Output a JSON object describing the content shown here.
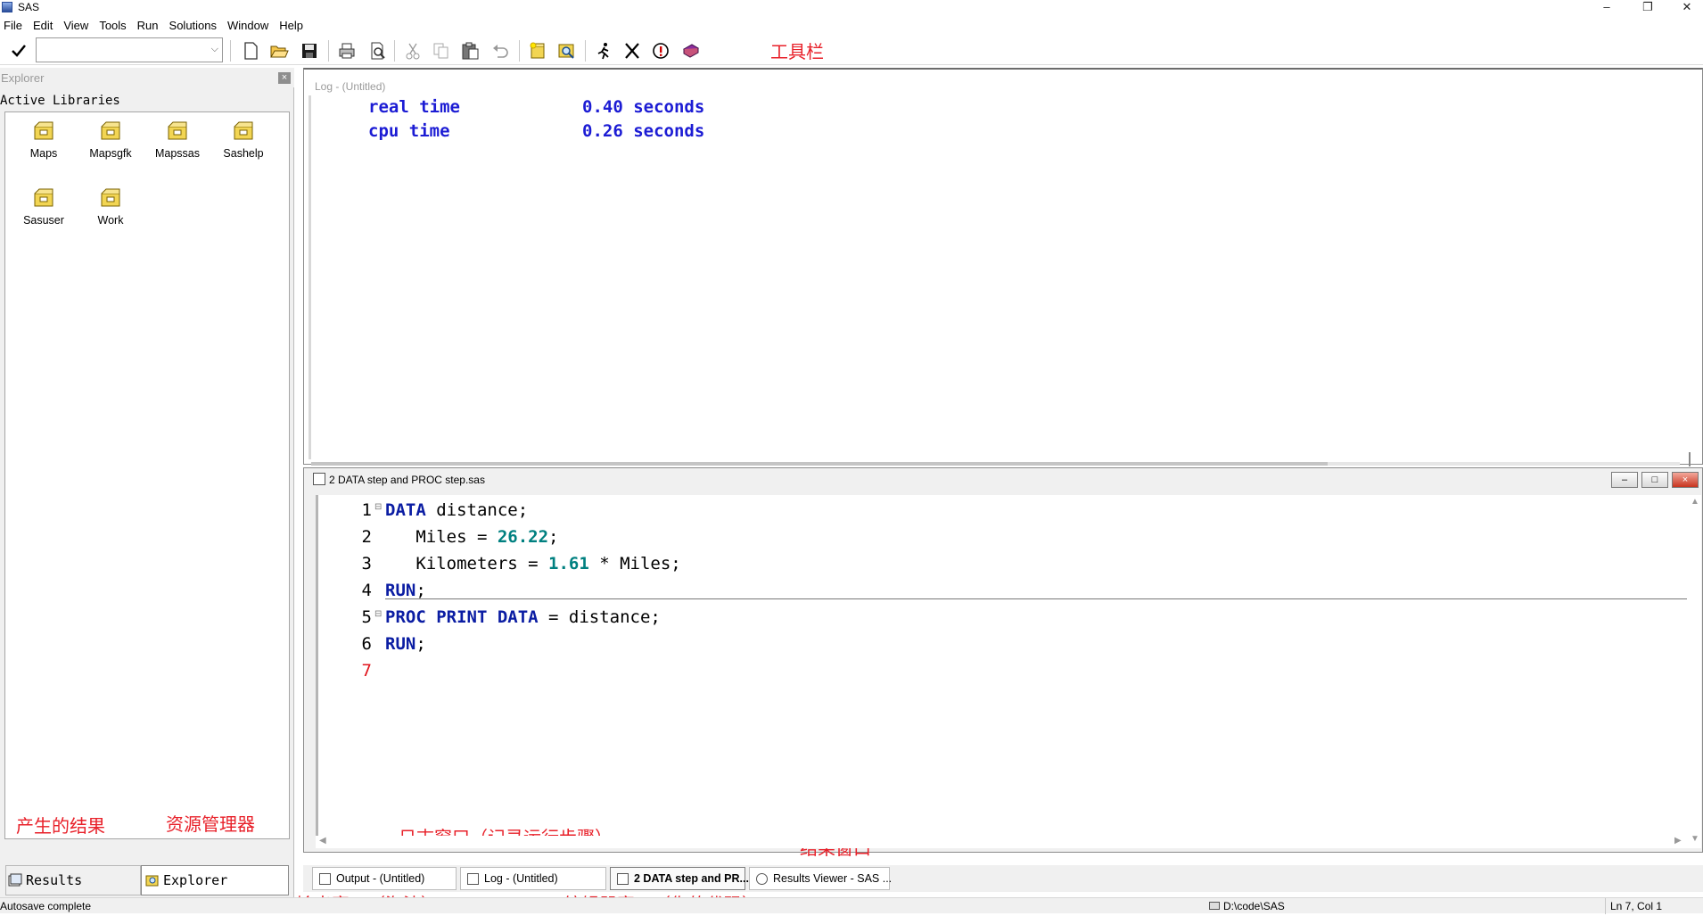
{
  "app": {
    "title": "SAS"
  },
  "menu": [
    "File",
    "Edit",
    "View",
    "Tools",
    "Run",
    "Solutions",
    "Window",
    "Help"
  ],
  "toolbar": {
    "command_value": "",
    "annotation": "工具栏",
    "icons": [
      "check-icon",
      "new-icon",
      "open-icon",
      "save-icon",
      "print-icon",
      "print-preview-icon",
      "cut-icon",
      "copy-icon",
      "paste-icon",
      "undo-icon",
      "new-library-icon",
      "explorer-icon",
      "submit-icon",
      "clear-icon",
      "break-icon",
      "help-icon"
    ]
  },
  "explorer": {
    "title": "Explorer",
    "heading": "Active Libraries",
    "libraries": [
      "Maps",
      "Mapsgfk",
      "Mapssas",
      "Sashelp",
      "Sasuser",
      "Work"
    ],
    "annotation_results": "产生的结果",
    "annotation_explorer": "资源管理器",
    "tabs": [
      "Results",
      "Explorer"
    ]
  },
  "log": {
    "title": "Log - (Untitled)",
    "lines": [
      {
        "label": "real time",
        "value": "0.40 seconds"
      },
      {
        "label": "cpu time",
        "value": "0.26 seconds"
      }
    ],
    "annotation": "日志窗口（记录运行步骤）"
  },
  "editor": {
    "title": "2 DATA step and PROC step.sas",
    "line_numbers": [
      "1",
      "2",
      "3",
      "4",
      "5",
      "6",
      "7"
    ],
    "code": {
      "l1_kw": "DATA",
      "l1_rest": " distance;",
      "l2_pre": "   Miles = ",
      "l2_num": "26.22",
      "l2_post": ";",
      "l3_pre": "   Kilometers = ",
      "l3_num": "1.61",
      "l3_post": " * Miles;",
      "l4_kw": "RUN",
      "l4_post": ";",
      "l5_kw": "PROC PRINT DATA",
      "l5_rest": " = distance;",
      "l6_kw": "RUN",
      "l6_post": ";"
    },
    "annotation_results": "结果窗口"
  },
  "window_tabs": [
    {
      "label": "Output - (Untitled)"
    },
    {
      "label": "Log - (Untitled)"
    },
    {
      "label": "2 DATA step and PR..."
    },
    {
      "label": "Results Viewer - SAS ..."
    }
  ],
  "annotations_bottom": {
    "output": "输出窗口（淘汰）",
    "editor": "编辑器窗口（你的代码）"
  },
  "status": {
    "message": "Autosave complete",
    "path": "D:\\code\\SAS",
    "cursor": "Ln 7, Col 1"
  }
}
